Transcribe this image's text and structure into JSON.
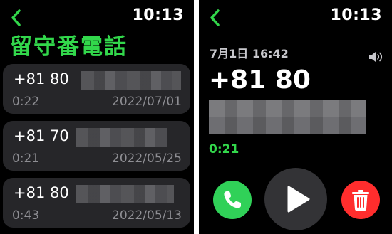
{
  "left": {
    "time": "10:13",
    "title": "留守番電話",
    "voicemails": [
      {
        "number": "+81 80",
        "duration": "0:22",
        "date": "2022/07/01"
      },
      {
        "number": "+81 70",
        "duration": "0:21",
        "date": "2022/05/25"
      },
      {
        "number": "+81 80",
        "duration": "0:43",
        "date": "2022/05/13"
      }
    ]
  },
  "right": {
    "time": "10:13",
    "date": "7月1日 16:42",
    "number": "+81 80",
    "duration": "0:21"
  },
  "icons": [
    "chevron-left-icon",
    "speaker-icon",
    "phone-icon",
    "play-icon",
    "trash-icon"
  ],
  "colors": {
    "accent_green": "#32d74b",
    "call_green": "#30d158",
    "delete_red": "#ff2d2d",
    "card_bg": "#262629"
  }
}
